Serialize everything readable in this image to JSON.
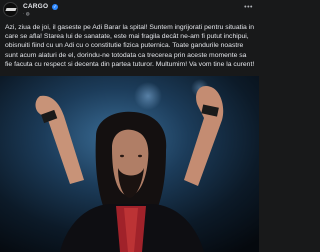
{
  "post": {
    "page_name": "CARGO",
    "verified_icon": "verified-badge-icon",
    "audience_icon": "globe-icon",
    "meta": "·",
    "more_icon": "more-horizontal-icon",
    "text": "Azi, ziua de joi, il gaseste pe Adi Barar la spital! Suntem ingrijorati pentru situatia in care se afla! Starea lui de sanatate, este mai fragila decât ne-am fi putut inchipui, obisnuiti fiind cu un Adi cu o constitutie fizica puternica. Toate gandurile noastre sunt acum alaturi de el, dorindu-ne totodata ca trecerea prin aceste momente sa fie facuta cu respect si decenta din partea tuturor. Multumim! Va vom tine la curent!",
    "photo_subject": "musician-with-raised-fists-photo"
  }
}
